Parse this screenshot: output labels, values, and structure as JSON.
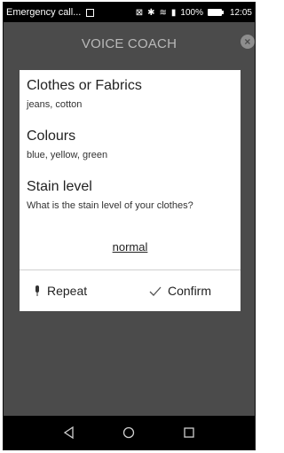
{
  "status_bar": {
    "carrier": "Emergency call...",
    "battery": "100%",
    "time": "12:05"
  },
  "header": {
    "title": "VOICE COACH",
    "close_icon": "close-icon"
  },
  "card": {
    "sections": [
      {
        "title": "Clothes or Fabrics",
        "subtitle": "jeans, cotton"
      },
      {
        "title": "Colours",
        "subtitle": "blue, yellow, green"
      },
      {
        "title": "Stain level",
        "subtitle": "What is the stain level of your clothes?"
      }
    ],
    "selected_value": "normal",
    "actions": {
      "repeat_label": "Repeat",
      "confirm_label": "Confirm"
    }
  },
  "nav_bar": {
    "icons": [
      "back-icon",
      "home-icon",
      "recents-icon"
    ]
  },
  "colors": {
    "background": "#4b4b4b",
    "card": "#ffffff",
    "header_text": "#b9b9b9"
  }
}
